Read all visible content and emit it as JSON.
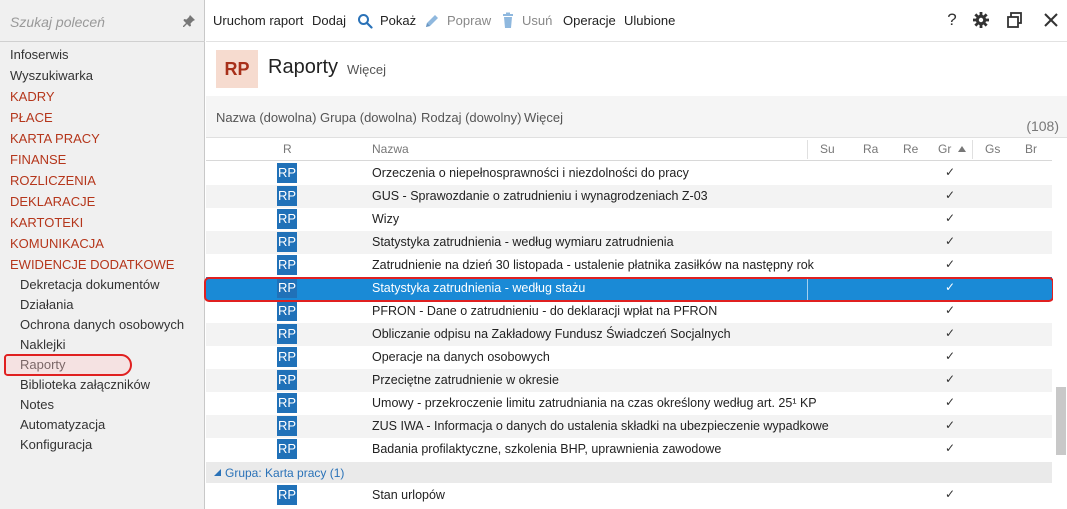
{
  "sidebar": {
    "search_placeholder": "Szukaj poleceń",
    "items": [
      {
        "label": "Infoserwis",
        "type": "plain"
      },
      {
        "label": "Wyszukiwarka",
        "type": "plain"
      },
      {
        "label": "KADRY",
        "type": "section"
      },
      {
        "label": "PŁACE",
        "type": "section"
      },
      {
        "label": "KARTA PRACY",
        "type": "section"
      },
      {
        "label": "FINANSE",
        "type": "section"
      },
      {
        "label": "ROZLICZENIA",
        "type": "section"
      },
      {
        "label": "DEKLARACJE",
        "type": "section"
      },
      {
        "label": "KARTOTEKI",
        "type": "section"
      },
      {
        "label": "KOMUNIKACJA",
        "type": "section"
      },
      {
        "label": "EWIDENCJE DODATKOWE",
        "type": "section"
      }
    ],
    "subitems": [
      {
        "label": "Dekretacja dokumentów"
      },
      {
        "label": "Działania"
      },
      {
        "label": "Ochrona danych osobowych"
      },
      {
        "label": "Naklejki"
      },
      {
        "label": "Raporty",
        "selected": true
      },
      {
        "label": "Biblioteka załączników"
      },
      {
        "label": "Notes"
      },
      {
        "label": "Automatyzacja"
      },
      {
        "label": "Konfiguracja"
      }
    ]
  },
  "toolbar": {
    "run_report": "Uruchom raport",
    "add": "Dodaj",
    "show": "Pokaż",
    "edit": "Popraw",
    "delete": "Usuń",
    "operations": "Operacje",
    "favorites": "Ulubione",
    "help": "?"
  },
  "header": {
    "badge": "RP",
    "title": "Raporty",
    "more": "Więcej"
  },
  "filters": {
    "name": "Nazwa (dowolna)",
    "group": "Grupa (dowolna)",
    "kind": "Rodzaj (dowolny)",
    "more": "Więcej",
    "count": "(108)"
  },
  "grid": {
    "columns": {
      "r": "R",
      "name": "Nazwa",
      "su": "Su",
      "ra": "Ra",
      "re": "Re",
      "gr": "Gr",
      "gs": "Gs",
      "br": "Br"
    },
    "rows": [
      {
        "icon": "RP",
        "name": "Orzeczenia o niepełnosprawności i niezdolności do pracy",
        "check": "✓"
      },
      {
        "icon": "RP",
        "name": "GUS - Sprawozdanie o zatrudnieniu i wynagrodzeniach Z-03",
        "check": "✓"
      },
      {
        "icon": "RP",
        "name": "Wizy",
        "check": "✓"
      },
      {
        "icon": "RP",
        "name": "Statystyka zatrudnienia - według wymiaru zatrudnienia",
        "check": "✓"
      },
      {
        "icon": "RP",
        "name": "Zatrudnienie na dzień 30 listopada - ustalenie płatnika zasiłków na następny rok",
        "check": "✓"
      },
      {
        "icon": "RP",
        "name": "Statystyka zatrudnienia - według stażu",
        "check": "✓",
        "selected": true
      },
      {
        "icon": "RP",
        "name": "PFRON - Dane o zatrudnieniu - do deklaracji wpłat na PFRON",
        "check": "✓"
      },
      {
        "icon": "RP",
        "name": "Obliczanie odpisu na Zakładowy Fundusz Świadczeń Socjalnych",
        "check": "✓"
      },
      {
        "icon": "RP",
        "name": "Operacje na danych osobowych",
        "check": "✓"
      },
      {
        "icon": "RP",
        "name": "Przeciętne zatrudnienie w okresie",
        "check": "✓"
      },
      {
        "icon": "RP",
        "name": "Umowy - przekroczenie limitu zatrudniania na czas określony według art. 25¹ KP",
        "check": "✓"
      },
      {
        "icon": "RP",
        "name": "ZUS IWA - Informacja o danych do ustalenia składki na ubezpieczenie wypadkowe",
        "check": "✓"
      },
      {
        "icon": "RP",
        "name": "Badania profilaktyczne, szkolenia BHP, uprawnienia zawodowe",
        "check": "✓"
      }
    ],
    "group_label": "Grupa: Karta pracy (1)",
    "group_rows": [
      {
        "icon": "RP",
        "name": "Stan urlopów",
        "check": "✓"
      }
    ]
  },
  "colors": {
    "accent": "#b5361b",
    "selection": "#1a8ad6",
    "rp_icon": "#2071b8",
    "highlight": "#e02020"
  }
}
